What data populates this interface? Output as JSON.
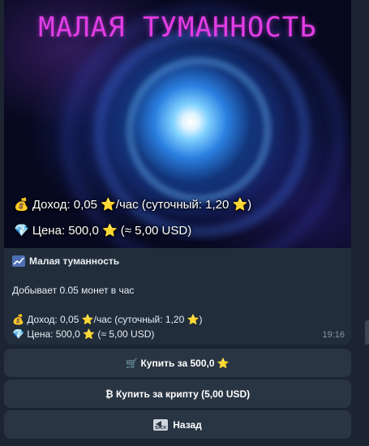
{
  "message": {
    "banner_title": "МАЛАЯ ТУМАННОСТЬ",
    "banner_income": "💰 Доход: 0,05 ⭐/час (суточный: 1,20 ⭐)",
    "banner_price": "💎 Цена: 500,0 ⭐ (≈ 5,00 USD)",
    "title": "Малая туманность",
    "description": "Добывает 0.05 монет в час",
    "income": "💰 Доход: 0,05 ⭐/час (суточный: 1,20 ⭐)",
    "price": "💎 Цена: 500,0 ⭐ (≈ 5,00 USD)",
    "time": "19:16"
  },
  "buttons": {
    "buy_stars": "🛒 Купить за 500,0 ⭐",
    "buy_crypto": "₿ Купить за крипту (5,00 USD)",
    "back": "Назад"
  },
  "icons": {
    "title_icon": "chart-icon",
    "back_icon": "back-arrow-icon"
  },
  "colors": {
    "background": "#1b2430",
    "bubble": "#212d3b",
    "button": "#2a3543",
    "title_magenta": "#e23de6"
  }
}
